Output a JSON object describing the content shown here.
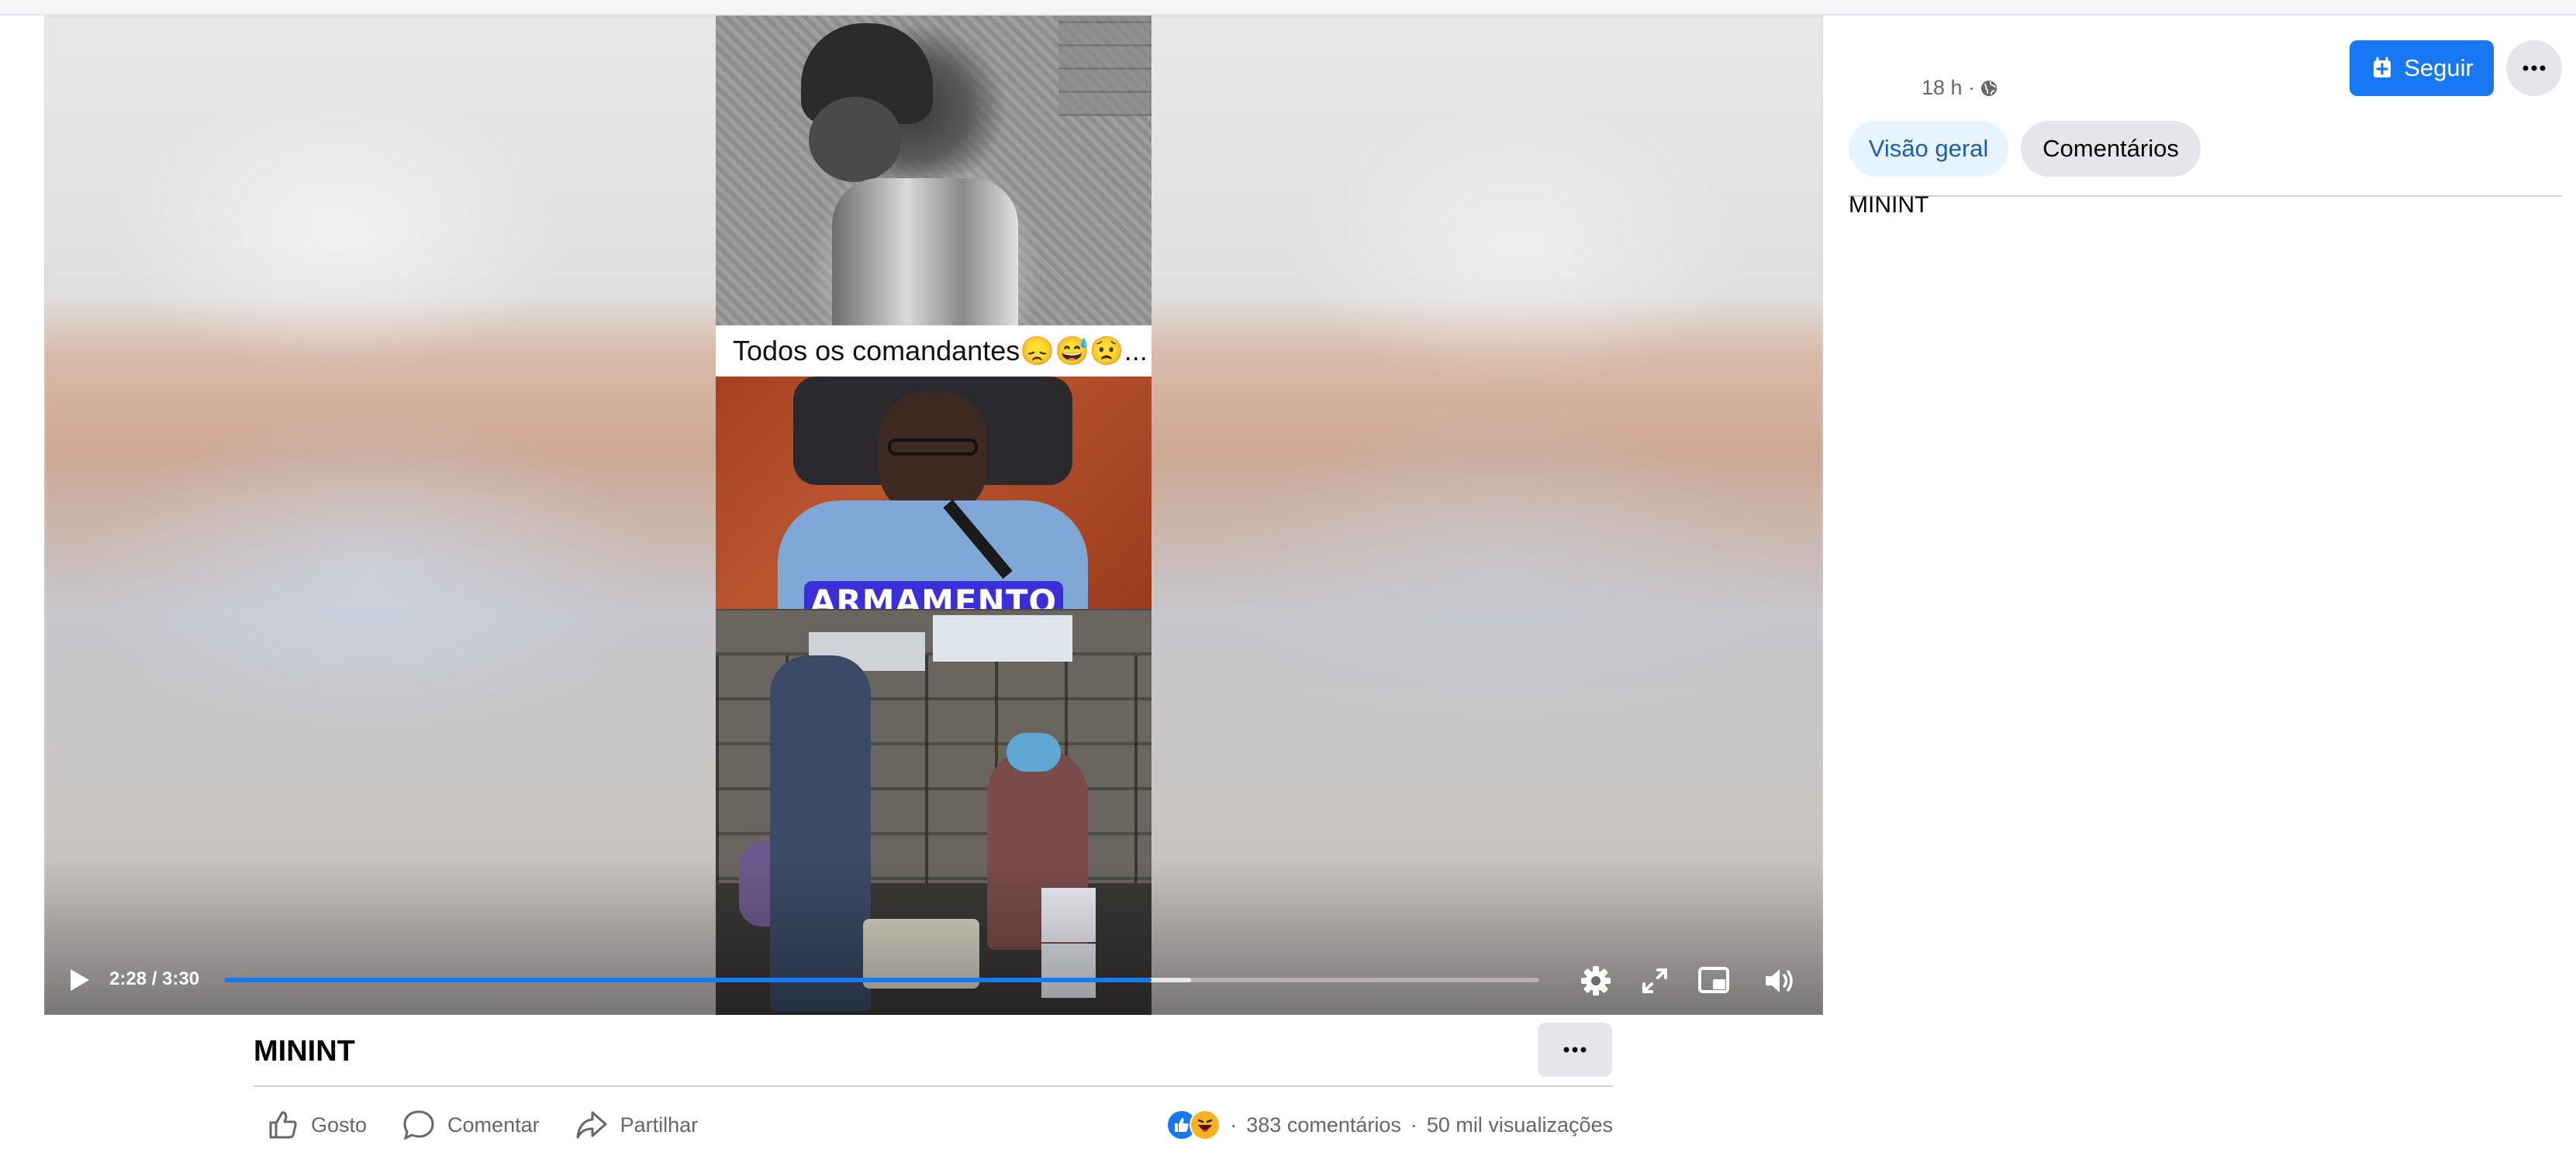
{
  "video": {
    "caption_overlay": "Todos os comandantes😞😅😟...",
    "text_overlay": "ARMAMENTO",
    "time_display": "2:28 / 3:30",
    "progress_played": 0.705,
    "progress_buffered": 0.735,
    "accent_color": "#1877f2",
    "controls": {
      "play_icon": "play-icon",
      "settings_icon": "gear-icon",
      "fullscreen_icon": "expand-icon",
      "pip_icon": "picture-in-picture-icon",
      "volume_icon": "volume-icon"
    }
  },
  "post": {
    "title": "MININT",
    "actions": {
      "like": "Gosto",
      "comment": "Comentar",
      "share": "Partilhar"
    },
    "stats": {
      "comments": "383 comentários",
      "views": "50 mil visualizações",
      "separator": "·"
    }
  },
  "side_panel": {
    "time": "18 h ·",
    "follow_label": "Seguir",
    "tabs": [
      {
        "label": "Visão geral",
        "active": true
      },
      {
        "label": "Comentários",
        "active": false
      }
    ],
    "description": "MININT"
  }
}
